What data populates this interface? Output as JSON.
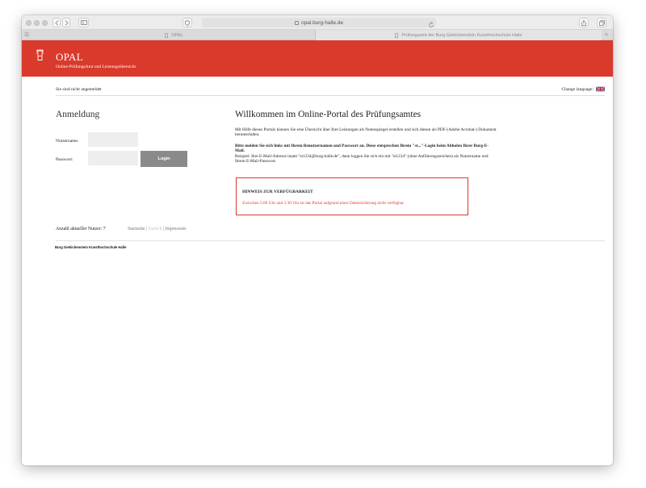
{
  "browser": {
    "address": "opal.burg-halle.de",
    "tabs": [
      {
        "label": "OPAL"
      },
      {
        "label": "Prüfungsamt der Burg Giebichenstein Kunsthochschule Halle"
      }
    ]
  },
  "header": {
    "title": "OPAL",
    "subtitle": "Online-PrüfungsAmt und Leistungsübersicht",
    "brand_color": "#d93a2b"
  },
  "status": {
    "login_state": "Sie sind nicht angemeldet",
    "change_language": "Change language:"
  },
  "login": {
    "title": "Anmeldung",
    "username_label": "Nutzername:",
    "password_label": "Passwort:",
    "username_value": "",
    "password_value": "",
    "button_label": "Login"
  },
  "welcome": {
    "title": "Willkommen im Online-Portal des Prüfungsamtes",
    "intro": "Mit Hilfe dieses Portals können Sie eine Übersicht über Ihre Leistungen als Notenspiegel erstellen und sich diesen als PDF-(Adobe Acrobat-) Dokument herunterladen.",
    "instruction_bold": "Bitte melden Sie sich links mit Ihrem Benutzernamen und Passwort an. Diese entsprechen Ihrem \"st...\"-Login beim Abholen Ihrer Burg-E-Mail.",
    "example": "Beispiel: Ihre E-Mail-Adresse lautet \"st1234@burg-halle.de\", dann loggen Sie sich ein mit \"st1234\" (ohne Anführungszeichen) als Nutzername und Ihrem E-Mail-Passwort."
  },
  "notice": {
    "title": "HINWEIS ZUR VERFÜGBARKEIT",
    "text": "Zwischen 5:00 Uhr und 5:30 Uhr ist das Portal aufgrund einer Datensicherung nicht verfügbar."
  },
  "footer": {
    "user_count": "Anzahl aktueller Nutzer: 7",
    "links": {
      "start": "Startseite",
      "back": "Zurück",
      "imprint": "Impressum",
      "separator": "|"
    },
    "org_name": "Burg Giebichenstein Kunsthochschule Halle"
  }
}
